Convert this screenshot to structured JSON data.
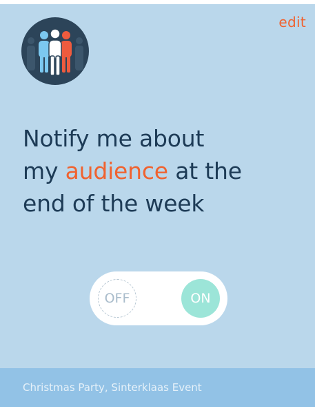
{
  "header": {
    "avatar_icon": "audience-people-icon",
    "edit_label": "edit"
  },
  "headline": {
    "line1": "Notify me about",
    "line2_prefix": "my ",
    "line2_accent": "audience",
    "line2_suffix": " at the",
    "line3": "end of the week"
  },
  "toggle": {
    "off_label": "OFF",
    "on_label": "ON",
    "state": "on"
  },
  "footer": {
    "events": "Christmas Party, Sinterklaas Event"
  },
  "colors": {
    "card_background": "#bad7eb",
    "accent": "#f0622f",
    "headline": "#1d3b56",
    "toggle_on": "#9ce5d8",
    "footer_background": "#92c2e6"
  }
}
